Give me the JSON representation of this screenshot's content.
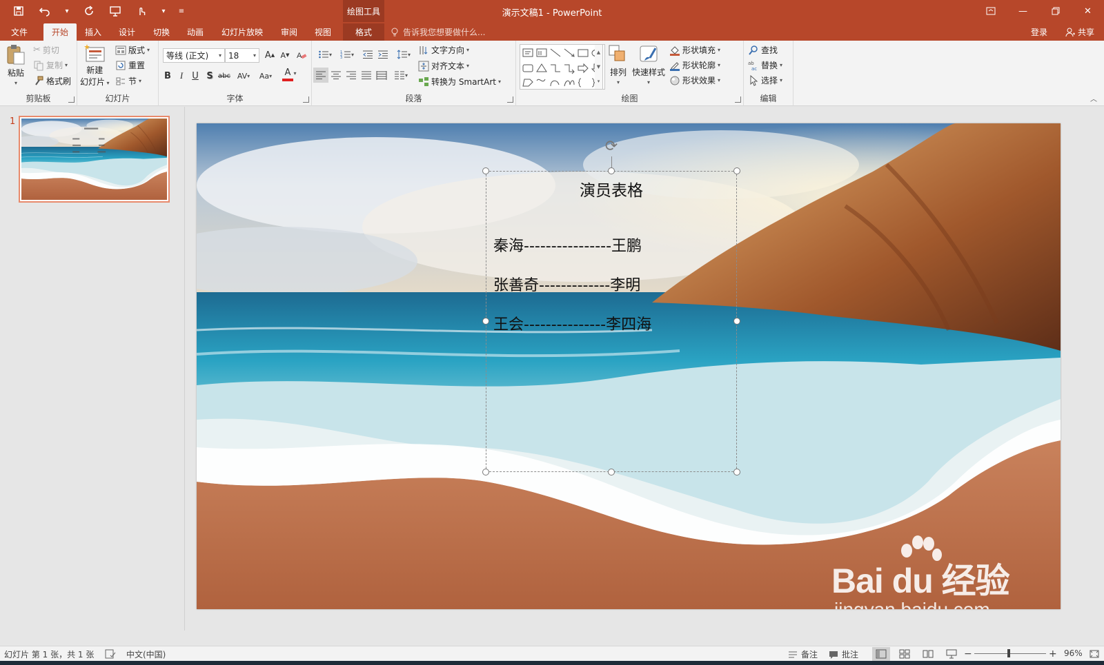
{
  "colors": {
    "accent": "#b7472a",
    "accent_dark": "#9b3a22",
    "ribbon_bg": "#f3f3f3",
    "pane_bg": "#e6e6e6"
  },
  "titlebar": {
    "doc_title": "演示文稿1 - PowerPoint",
    "context_label": "绘图工具",
    "qat_icons": [
      "save-icon",
      "undo-icon",
      "redo-icon",
      "present-icon",
      "touch-mode-icon",
      "customize-qat-icon"
    ]
  },
  "tabs": {
    "file": "文件",
    "home": "开始",
    "insert": "插入",
    "design": "设计",
    "transitions": "切换",
    "animations": "动画",
    "slideshow": "幻灯片放映",
    "review": "审阅",
    "view": "视图",
    "format": "格式"
  },
  "tellme": "告诉我您想要做什么...",
  "signin": "登录",
  "share": "共享",
  "ribbon": {
    "clipboard": {
      "label": "剪贴板",
      "paste": "粘贴",
      "cut": "剪切",
      "copy": "复制",
      "format_painter": "格式刷"
    },
    "slides": {
      "label": "幻灯片",
      "new_slide_1": "新建",
      "new_slide_2": "幻灯片",
      "layout": "版式",
      "reset": "重置",
      "section": "节"
    },
    "font": {
      "label": "字体",
      "font_name": "等线 (正文)",
      "font_size": "18",
      "bold": "B",
      "italic": "I",
      "underline": "U",
      "shadow": "S",
      "strike": "abc",
      "spacing": "AV",
      "case": "Aa",
      "color": "A",
      "grow": "A",
      "shrink": "A"
    },
    "paragraph": {
      "label": "段落",
      "text_direction": "文字方向",
      "align_text": "对齐文本",
      "smartart": "转换为 SmartArt"
    },
    "drawing": {
      "label": "绘图",
      "arrange": "排列",
      "quick_styles": "快速样式",
      "shape_fill": "形状填充",
      "shape_outline": "形状轮廓",
      "shape_effects": "形状效果"
    },
    "editing": {
      "label": "编辑",
      "find": "查找",
      "replace": "替换",
      "select": "选择"
    }
  },
  "thumbnails": [
    {
      "number": "1"
    }
  ],
  "slide": {
    "title": "演员表格",
    "lines": [
      {
        "left": "秦海",
        "dashes": "----------------",
        "right": "王鹏"
      },
      {
        "left": "张善奇",
        "dashes": "-------------",
        "right": "李明"
      },
      {
        "left": "王会",
        "dashes": "---------------",
        "right": "李四海"
      }
    ],
    "watermark_logo": "Bai du 经验",
    "watermark_url": "jingyan.baidu.com"
  },
  "statusbar": {
    "slide_info": "幻灯片 第 1 张，共 1 张",
    "language": "中文(中国)",
    "notes": "备注",
    "comments": "批注",
    "zoom": "96%"
  }
}
